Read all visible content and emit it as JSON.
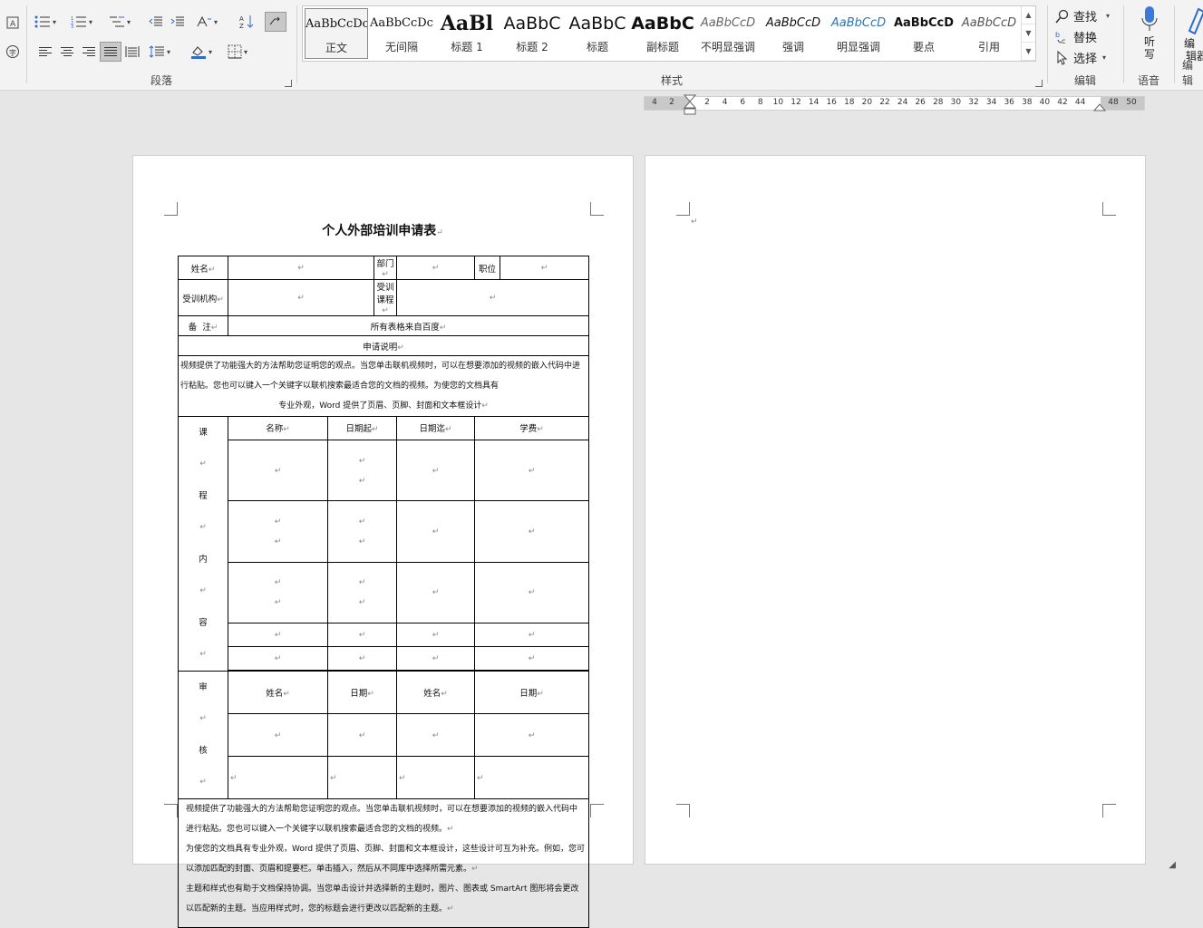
{
  "ribbon": {
    "paragraph_label": "段落",
    "styles_label": "样式",
    "editing_label": "编辑",
    "voice_label": "语音",
    "editor_label": "编辑",
    "styles": [
      {
        "sample": "AaBbCcDc",
        "name": "正文",
        "selected": true
      },
      {
        "sample": "AaBbCcDc",
        "name": "无间隔"
      },
      {
        "sample": "AaBl",
        "name": "标题 1"
      },
      {
        "sample": "AaBbC",
        "name": "标题 2"
      },
      {
        "sample": "AaBbC",
        "name": "标题"
      },
      {
        "sample": "AaBbC",
        "name": "副标题"
      },
      {
        "sample": "AaBbCcD",
        "name": "不明显强调"
      },
      {
        "sample": "AaBbCcD",
        "name": "强调"
      },
      {
        "sample": "AaBbCcD",
        "name": "明显强调"
      },
      {
        "sample": "AaBbCcD",
        "name": "要点"
      },
      {
        "sample": "AaBbCcD",
        "name": "引用"
      }
    ],
    "find": "查找",
    "replace": "替换",
    "select": "选择",
    "dictate_line1": "听",
    "dictate_line2": "写",
    "editor_line1": "编",
    "editor_line2": "辑器"
  },
  "ruler": {
    "left_numbers": [
      "4",
      "2"
    ],
    "numbers": [
      "2",
      "4",
      "6",
      "8",
      "10",
      "12",
      "14",
      "16",
      "18",
      "20",
      "22",
      "24",
      "26",
      "28",
      "30",
      "32",
      "34",
      "36",
      "38",
      "40",
      "42",
      "44"
    ],
    "right_numbers": [
      "48",
      "50"
    ]
  },
  "document": {
    "title": "个人外部培训申请表",
    "paragraph_mark": "↵",
    "row1": {
      "name": "姓名",
      "dept": "部门",
      "position": "职位"
    },
    "row2": {
      "institution": "受训机构",
      "course": "受训课程"
    },
    "row3": {
      "remark_label": "备  注",
      "remark_value": "所有表格来自百度"
    },
    "explain_header": "申请说明",
    "explain_text": "视频提供了功能强大的方法帮助您证明您的观点。当您单击联机视频时，可以在想要添加的视频的嵌入代码中进行粘贴。您也可以键入一个关键字以联机搜索最适合您的文档的视频。为使您的文档具有",
    "explain_text_last": "专业外观，Word 提供了页眉、页脚、封面和文本框设计",
    "course_label_chars": [
      "课",
      "程",
      "内",
      "容"
    ],
    "course_headers": [
      "名称",
      "日期起",
      "日期迄",
      "学费"
    ],
    "review_label_chars": [
      "审",
      "核"
    ],
    "review_headers": [
      "姓名",
      "日期",
      "姓名",
      "日期"
    ],
    "footer_paragraphs": [
      "视频提供了功能强大的方法帮助您证明您的观点。当您单击联机视频时，可以在想要添加的视频的嵌入代码中进行粘贴。您也可以键入一个关键字以联机搜索最适合您的文档的视频。",
      "为使您的文档具有专业外观，Word 提供了页眉、页脚、封面和文本框设计，这些设计可互为补充。例如，您可以添加匹配的封面、页眉和提要栏。单击插入，然后从不同库中选择所需元素。",
      "主题和样式也有助于文档保持协调。当您单击设计并选择新的主题时，图片、图表或 SmartArt 图形将会更改以匹配新的主题。当应用样式时，您的标题会进行更改以匹配新的主题。"
    ]
  }
}
